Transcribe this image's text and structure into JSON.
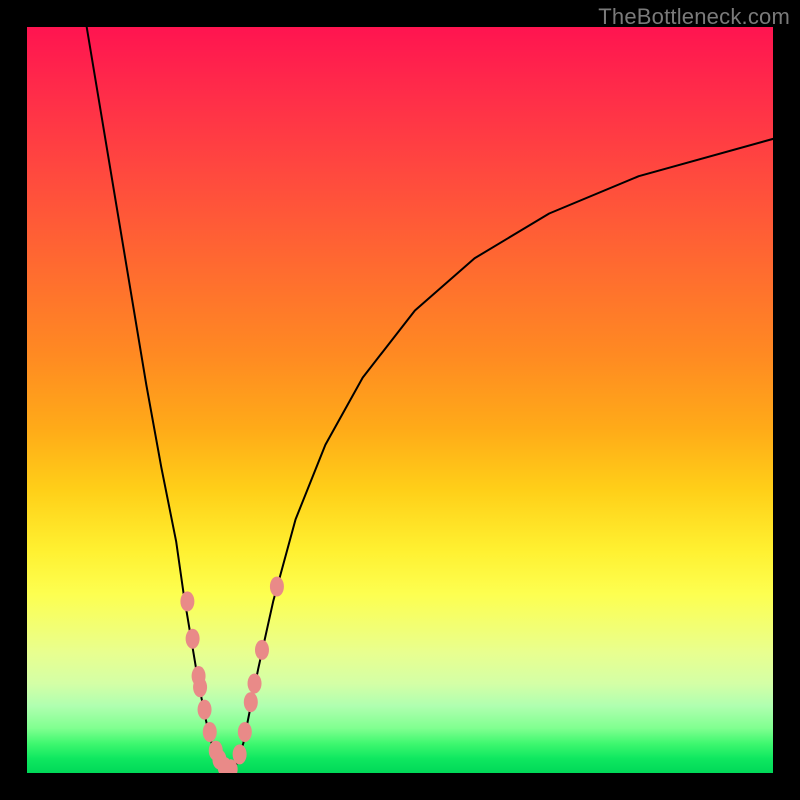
{
  "watermark": "TheBottleneck.com",
  "chart_data": {
    "type": "line",
    "title": "",
    "xlabel": "",
    "ylabel": "",
    "xlim": [
      0,
      100
    ],
    "ylim": [
      0,
      100
    ],
    "background": "red-yellow-green vertical gradient (red top, green bottom)",
    "curves": [
      {
        "name": "left-branch",
        "description": "steep descending curve from top-left toward valley",
        "points_xy": [
          [
            8,
            100
          ],
          [
            10,
            88
          ],
          [
            12,
            76
          ],
          [
            14,
            64
          ],
          [
            16,
            52
          ],
          [
            18,
            41
          ],
          [
            20,
            31
          ],
          [
            21,
            24
          ],
          [
            22,
            18
          ],
          [
            23,
            12
          ],
          [
            24,
            7
          ],
          [
            25,
            3
          ],
          [
            26,
            1
          ],
          [
            27,
            0
          ]
        ]
      },
      {
        "name": "right-branch",
        "description": "rising curve from valley toward upper-right, flattening",
        "points_xy": [
          [
            27,
            0
          ],
          [
            28,
            1
          ],
          [
            29,
            4
          ],
          [
            30,
            9
          ],
          [
            31,
            14
          ],
          [
            33,
            23
          ],
          [
            36,
            34
          ],
          [
            40,
            44
          ],
          [
            45,
            53
          ],
          [
            52,
            62
          ],
          [
            60,
            69
          ],
          [
            70,
            75
          ],
          [
            82,
            80
          ],
          [
            100,
            85
          ]
        ]
      }
    ],
    "markers": {
      "description": "pink rounded markers clustered near the valley on both branches",
      "color": "#e98a88",
      "points_xy": [
        [
          21.5,
          23
        ],
        [
          22.2,
          18
        ],
        [
          23.0,
          13
        ],
        [
          23.2,
          11.5
        ],
        [
          23.8,
          8.5
        ],
        [
          24.5,
          5.5
        ],
        [
          25.3,
          3.0
        ],
        [
          25.8,
          1.8
        ],
        [
          26.5,
          0.8
        ],
        [
          27.3,
          0.5
        ],
        [
          28.5,
          2.5
        ],
        [
          29.2,
          5.5
        ],
        [
          30.0,
          9.5
        ],
        [
          30.5,
          12.0
        ],
        [
          31.5,
          16.5
        ],
        [
          33.5,
          25.0
        ]
      ]
    }
  }
}
